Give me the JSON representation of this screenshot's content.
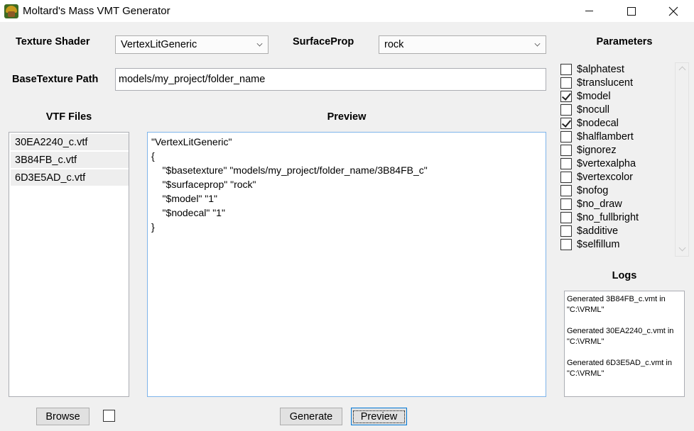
{
  "window": {
    "title": "Moltard's Mass VMT Generator",
    "minimize": "minimize",
    "maximize": "maximize",
    "close": "close"
  },
  "shader": {
    "label": "Texture Shader",
    "selected": "VertexLitGeneric"
  },
  "surfaceprop": {
    "label": "SurfaceProp",
    "selected": "rock"
  },
  "basetexture": {
    "label": "BaseTexture Path",
    "value": "models/my_project/folder_name"
  },
  "vtf_files": {
    "label": "VTF Files",
    "items": [
      "30EA2240_c.vtf",
      "3B84FB_c.vtf",
      "6D3E5AD_c.vtf"
    ]
  },
  "preview": {
    "label": "Preview",
    "lines": [
      "\"VertexLitGeneric\"",
      "{",
      "    \"$basetexture\" \"models/my_project/folder_name/3B84FB_c\"",
      "    \"$surfaceprop\" \"rock\"",
      "    \"$model\" \"1\"",
      "    \"$nodecal\" \"1\"",
      "}"
    ]
  },
  "parameters": {
    "label": "Parameters",
    "items": [
      {
        "name": "$alphatest",
        "checked": false
      },
      {
        "name": "$translucent",
        "checked": false
      },
      {
        "name": "$model",
        "checked": true
      },
      {
        "name": "$nocull",
        "checked": false
      },
      {
        "name": "$nodecal",
        "checked": true
      },
      {
        "name": "$halflambert",
        "checked": false
      },
      {
        "name": "$ignorez",
        "checked": false
      },
      {
        "name": "$vertexalpha",
        "checked": false
      },
      {
        "name": "$vertexcolor",
        "checked": false
      },
      {
        "name": "$nofog",
        "checked": false
      },
      {
        "name": "$no_draw",
        "checked": false
      },
      {
        "name": "$no_fullbright",
        "checked": false
      },
      {
        "name": "$additive",
        "checked": false
      },
      {
        "name": "$selfillum",
        "checked": false
      }
    ]
  },
  "logs": {
    "label": "Logs",
    "entries": [
      "Generated 3B84FB_c.vmt in \"C:\\VRML\"",
      "Generated 30EA2240_c.vmt in \"C:\\VRML\"",
      "Generated 6D3E5AD_c.vmt in \"C:\\VRML\""
    ]
  },
  "buttons": {
    "browse": "Browse",
    "generate": "Generate",
    "preview": "Preview"
  },
  "colors": {
    "window_bg": "#f0f0f0",
    "focus_border": "#0078d7",
    "preview_border": "#7eb4ea"
  }
}
